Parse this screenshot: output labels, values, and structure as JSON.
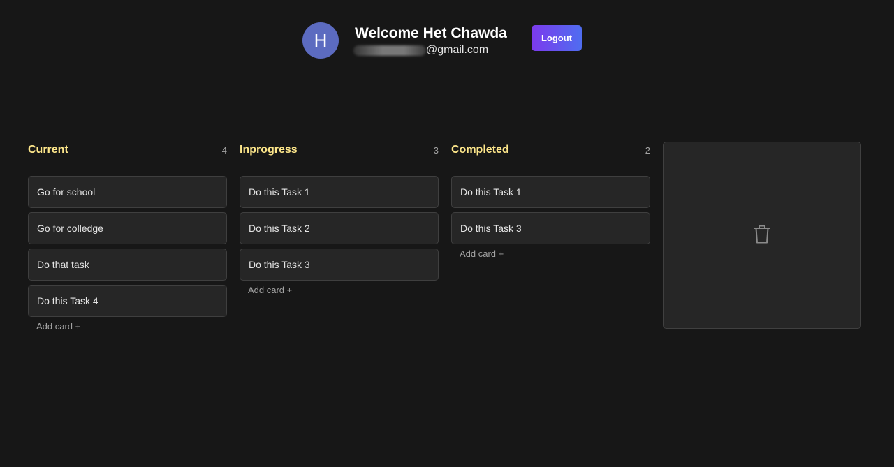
{
  "header": {
    "avatar_letter": "H",
    "welcome_text": "Welcome Het Chawda",
    "email_domain": "@gmail.com",
    "logout_label": "Logout"
  },
  "columns": [
    {
      "title": "Current",
      "count": "4",
      "cards": [
        "Go for school",
        "Go for colledge",
        "Do that task",
        "Do this Task 4"
      ],
      "add_label": "Add card +"
    },
    {
      "title": "Inprogress",
      "count": "3",
      "cards": [
        "Do this Task 1",
        "Do this Task 2",
        "Do this Task 3"
      ],
      "add_label": "Add card +"
    },
    {
      "title": "Completed",
      "count": "2",
      "cards": [
        "Do this Task 1",
        "Do this Task 3"
      ],
      "add_label": "Add card +"
    }
  ],
  "trash": {
    "icon": "trash-icon"
  },
  "colors": {
    "background": "#171717",
    "column_title": "#fde68a",
    "card_background": "#262626",
    "avatar": "#5c6bc0",
    "logout_gradient": [
      "#7c3aed",
      "#4f6df0"
    ]
  }
}
